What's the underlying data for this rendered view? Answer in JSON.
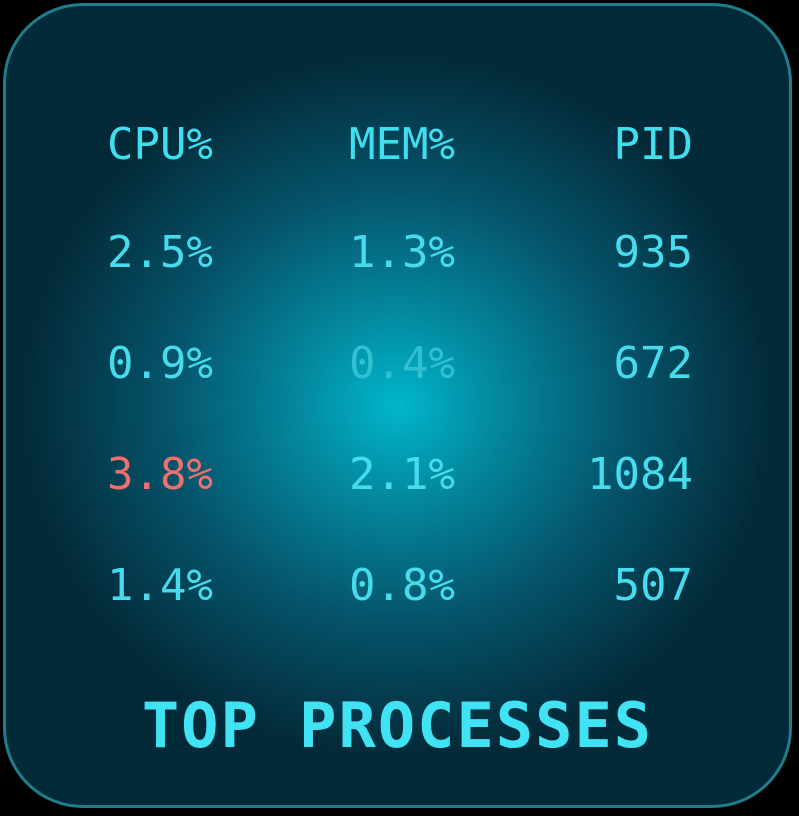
{
  "widget": {
    "title": "TOP PROCESSES",
    "columns": [
      "CPU%",
      "MEM%",
      "PID"
    ],
    "rows": [
      {
        "cpu": "2.5%",
        "mem": "1.3%",
        "pid": "935"
      },
      {
        "cpu": "0.9%",
        "mem": "0.4%",
        "pid": "672"
      },
      {
        "cpu": "3.8%",
        "mem": "2.1%",
        "pid": "1084"
      },
      {
        "cpu": "1.4%",
        "mem": "0.8%",
        "pid": "507"
      }
    ],
    "colors": {
      "border": "#1f7d8c",
      "text": "#46dced",
      "highlight": "#ef6f6c",
      "background_center": "#00b6cc",
      "background_edge": "#032a38"
    }
  }
}
